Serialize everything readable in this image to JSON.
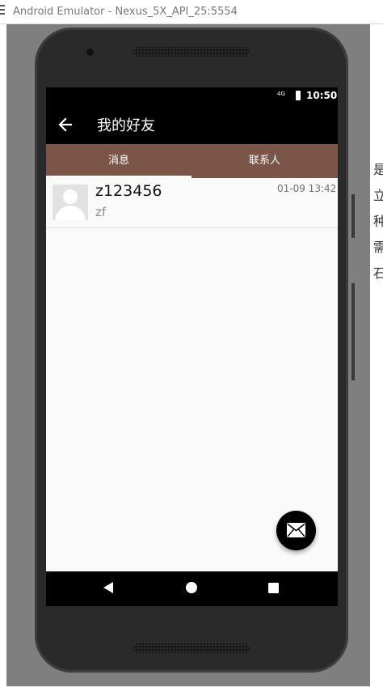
{
  "window": {
    "title": "Android Emulator - Nexus_5X_API_25:5554"
  },
  "status_bar": {
    "time": "10:50",
    "signal_label": "4G"
  },
  "app_bar": {
    "title": "我的好友",
    "back_icon": "arrow-left-icon"
  },
  "tabs": [
    {
      "label": "消息",
      "selected": true
    },
    {
      "label": "联系人",
      "selected": false
    }
  ],
  "conversations": [
    {
      "name": "z123456",
      "preview": "zf",
      "time": "01-09 13:42",
      "avatar_icon": "default-avatar-icon"
    }
  ],
  "fab": {
    "icon": "mail-icon"
  },
  "nav_bar": {
    "icons": [
      "back-triangle-icon",
      "home-circle-icon",
      "recents-square-icon"
    ]
  },
  "background_text_fragments": [
    "是",
    "立",
    "种",
    "需",
    "石"
  ],
  "colors": {
    "tab_bar": "#7b5547",
    "app_bar": "#000000",
    "screen_bg": "#fafafa"
  }
}
